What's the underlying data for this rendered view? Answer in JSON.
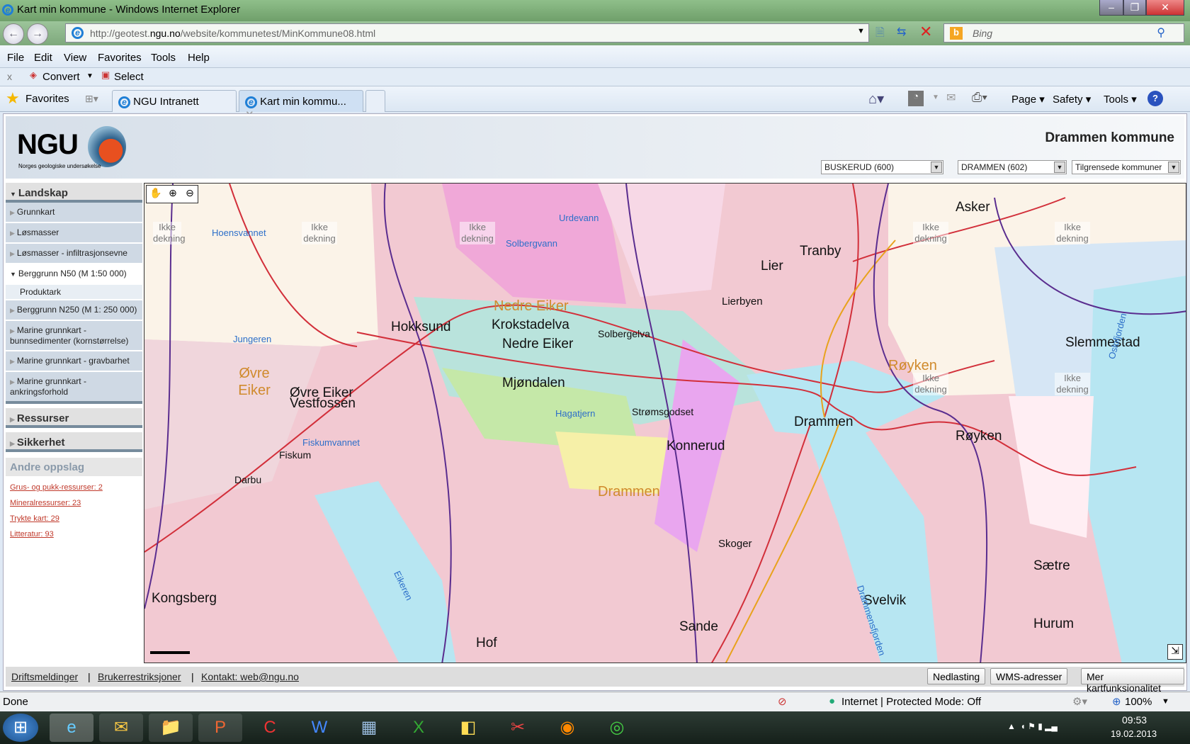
{
  "window": {
    "title": "Kart min kommune - Windows Internet Explorer"
  },
  "address": {
    "url_pre": "http://geotest.",
    "url_host": "ngu.no",
    "url_post": "/website/kommunetest/MinKommune08.html",
    "search_placeholder": "Bing"
  },
  "menu": [
    "File",
    "Edit",
    "View",
    "Favorites",
    "Tools",
    "Help"
  ],
  "cmdbar": {
    "close": "x",
    "convert": "Convert",
    "select": "Select"
  },
  "tabs": {
    "favorites": "Favorites",
    "items": [
      "NGU Intranett",
      "Kart min kommu..."
    ],
    "tools": [
      "Page",
      "Safety",
      "Tools"
    ]
  },
  "header": {
    "logo_text": "NGU",
    "logo_sub": "Norges geologiske undersøkelse",
    "municipality": "Drammen kommune",
    "selects": [
      "BUSKERUD (600)",
      "DRAMMEN (602)",
      "Tilgrensede kommuner"
    ]
  },
  "sidebar": {
    "landskap": "Landskap",
    "items": [
      "Grunnkart",
      "Løsmasser",
      "Løsmasser - infiltrasjonsevne",
      "Berggrunn N50 (M 1:50 000)",
      "Produktark",
      "Berggrunn N250 (M 1: 250 000)",
      "Marine grunnkart - bunnsedimenter (kornstørrelse)",
      "Marine grunnkart - gravbarhet",
      "Marine grunnkart - ankringsforhold"
    ],
    "ressurser": "Ressurser",
    "sikkerhet": "Sikkerhet",
    "andre": "Andre oppslag",
    "links": [
      "Grus- og pukk-ressurser: 2",
      "Mineralressurser: 23",
      "Trykte kart: 29",
      "Litteratur: 93"
    ]
  },
  "map": {
    "tools": [
      "pan-icon",
      "zoom-in-icon",
      "zoom-out-icon"
    ],
    "labels": [
      "Drammen",
      "Hokksund",
      "Mjøndalen",
      "Nedre Eiker",
      "Krokstadelva",
      "Lier",
      "Tranby",
      "Asker",
      "Røyken",
      "Svelvik",
      "Sande",
      "Hurum",
      "Kongsberg",
      "Øvre Eiker",
      "Vestfossen",
      "Konnerud",
      "Lierbyen",
      "Hof",
      "Sætre",
      "Slemmestad",
      "Skoger",
      "Strømsgodset",
      "Solbergelva",
      "Darbu",
      "Fiskum",
      "Drammen",
      "Nedre Eiker",
      "Øvre Eiker",
      "Røyken",
      "Drammensfjorden",
      "Eikeren",
      "Fiskumvannet",
      "Hoensvannet",
      "Jungeren",
      "Urdevann",
      "Solbergvann",
      "Hagatjern",
      "Oslofjorden",
      "Ikke dekning",
      "Ikke dekning",
      "Ikke dekning",
      "Ikke dekning",
      "Ikke dekning",
      "Ikke dekning",
      "Ikke dekning"
    ]
  },
  "footer": {
    "links": [
      "Driftsmeldinger",
      "Brukerrestriksjoner",
      "Kontakt: web@ngu.no"
    ],
    "buttons": [
      "Nedlasting",
      "WMS-adresser",
      "Mer kartfunksjonalitet"
    ]
  },
  "status": {
    "text": "Done",
    "zone": "Internet | Protected Mode: Off",
    "zoom": "100%"
  },
  "taskbar": {
    "time": "09:53",
    "date": "19.02.2013"
  },
  "colors": {
    "accent": "#c0392b",
    "sidebar_item": "#cfd9e4",
    "map_base": "#f2c9d2"
  }
}
